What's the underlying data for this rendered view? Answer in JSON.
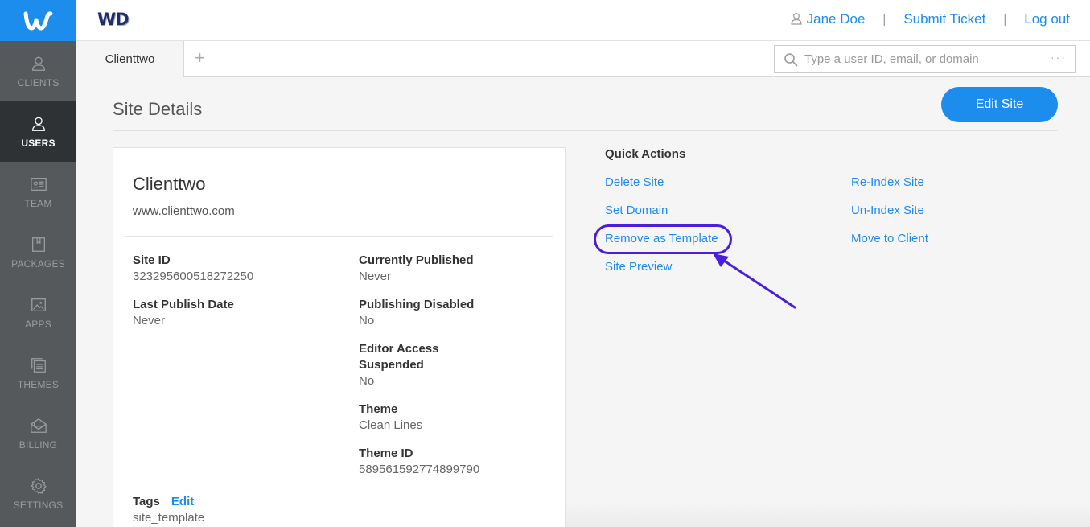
{
  "sidebar": {
    "logo_icon": "weebly-w-icon",
    "items": [
      {
        "label": "CLIENTS",
        "icon": "user-icon"
      },
      {
        "label": "USERS",
        "icon": "user-icon"
      },
      {
        "label": "TEAM",
        "icon": "id-card-icon"
      },
      {
        "label": "PACKAGES",
        "icon": "package-icon"
      },
      {
        "label": "APPS",
        "icon": "image-icon"
      },
      {
        "label": "THEMES",
        "icon": "layers-icon"
      },
      {
        "label": "BILLING",
        "icon": "envelope-icon"
      },
      {
        "label": "SETTINGS",
        "icon": "gear-icon"
      }
    ],
    "active": "USERS"
  },
  "header": {
    "brand": "WD",
    "user_name": "Jane Doe",
    "submit_ticket": "Submit Ticket",
    "logout": "Log out",
    "separator": "|"
  },
  "tabs": {
    "items": [
      {
        "label": "Clienttwo"
      }
    ],
    "add_label": "+"
  },
  "search": {
    "placeholder": "Type a user ID, email, or domain",
    "value": "",
    "more": "···"
  },
  "page": {
    "title": "Site Details",
    "edit_site_button": "Edit Site"
  },
  "site": {
    "name": "Clienttwo",
    "url": "www.clienttwo.com",
    "fields": {
      "site_id": {
        "label": "Site ID",
        "value": "323295600518272250"
      },
      "last_publish_date": {
        "label": "Last Publish Date",
        "value": "Never"
      },
      "currently_published": {
        "label": "Currently Published",
        "value": "Never"
      },
      "publishing_disabled": {
        "label": "Publishing Disabled",
        "value": "No"
      },
      "editor_access_suspended": {
        "label_line1": "Editor Access",
        "label_line2": "Suspended",
        "value": "No"
      },
      "theme": {
        "label": "Theme",
        "value": "Clean Lines"
      },
      "theme_id": {
        "label": "Theme ID",
        "value": "589561592774899790"
      },
      "tags": {
        "label": "Tags",
        "edit": "Edit",
        "value": "site_template"
      }
    }
  },
  "quick_actions": {
    "title": "Quick Actions",
    "left": [
      "Delete Site",
      "Set Domain",
      "Remove as Template",
      "Site Preview"
    ],
    "right": [
      "Re-Index Site",
      "Un-Index Site",
      "Move to Client"
    ]
  },
  "annotation": {
    "highlight_color": "#4a1fdb"
  },
  "colors": {
    "accent": "#1c8ced",
    "sidebar_bg": "#55595c",
    "sidebar_active_bg": "#2f3234"
  }
}
